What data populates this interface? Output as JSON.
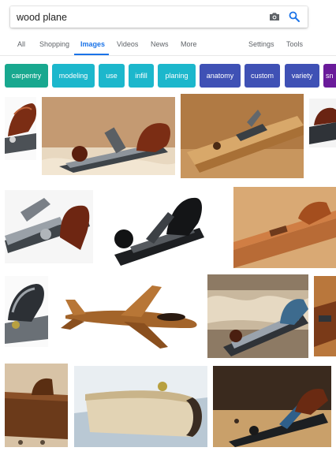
{
  "search": {
    "query": "wood plane"
  },
  "icons": {
    "camera": "camera-icon",
    "search": "search-icon"
  },
  "tabs": [
    {
      "label": "All",
      "active": false
    },
    {
      "label": "Shopping",
      "active": false
    },
    {
      "label": "Images",
      "active": true
    },
    {
      "label": "Videos",
      "active": false
    },
    {
      "label": "News",
      "active": false
    },
    {
      "label": "More",
      "active": false
    },
    {
      "label": "Settings",
      "active": false
    },
    {
      "label": "Tools",
      "active": false
    }
  ],
  "chips": [
    {
      "label": "carpentry",
      "color": "#18a88f"
    },
    {
      "label": "modeling",
      "color": "#1cb7cc"
    },
    {
      "label": "use",
      "color": "#1cb7cc"
    },
    {
      "label": "infill",
      "color": "#1cb7cc"
    },
    {
      "label": "planing",
      "color": "#1cb7cc"
    },
    {
      "label": "anatomy",
      "color": "#3f51b5"
    },
    {
      "label": "custom",
      "color": "#3f51b5"
    },
    {
      "label": "variety",
      "color": "#3f51b5"
    },
    {
      "label": "sn",
      "color": "#6a1b9a"
    }
  ],
  "colors": {
    "accent": "#1a73e8",
    "tab_text": "#5f6368",
    "wood": "#9a6a34",
    "mahogany": "#7a2b15",
    "metal": "#555a60"
  },
  "results": [
    {
      "subject": "hand-plane-red-tote-cropped"
    },
    {
      "subject": "hand-plane-on-shavings"
    },
    {
      "subject": "wooden-jack-plane"
    },
    {
      "subject": "hand-plane-cropped-right"
    },
    {
      "subject": "plane-closeup-rosewood"
    },
    {
      "subject": "black-hand-plane"
    },
    {
      "subject": "wooden-smoothing-plane"
    },
    {
      "subject": "plane-partial-left"
    },
    {
      "subject": "wooden-jet-model"
    },
    {
      "subject": "plane-in-workshop"
    },
    {
      "subject": "plane-partial-right"
    },
    {
      "subject": "wooden-router-plane"
    },
    {
      "subject": "wooden-plane-light-grain"
    },
    {
      "subject": "plane-on-workbench"
    }
  ]
}
